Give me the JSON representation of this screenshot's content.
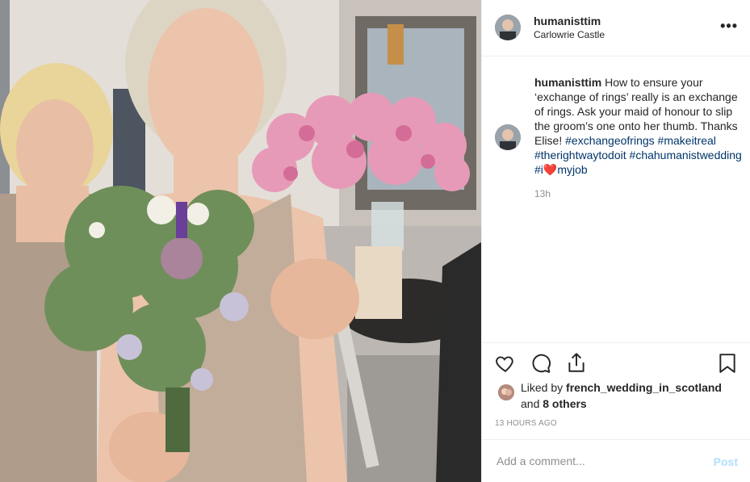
{
  "post": {
    "username": "humanisttim",
    "location": "Carlowrie Castle",
    "more_icon": "more-horizontal-icon",
    "caption": {
      "username": "humanisttim",
      "text": "How to ensure your ‘exchange of rings’ really is an exchange of rings. Ask your maid of honour to slip the groom’s one onto her thumb. Thanks Elise!",
      "hashtags": [
        "#exchangeofrings",
        "#makeitreal",
        "#therightwaytodoit",
        "#chahumanistwedding",
        "#i"
      ],
      "heart_emoji": "❤️",
      "tail_text": "myjob"
    },
    "caption_time": "13h",
    "likes": {
      "prefix": "Liked by",
      "user": "french_wedding_in_scotland",
      "and": "and",
      "others": "8 others"
    },
    "timestamp": "13 HOURS AGO",
    "comment_placeholder": "Add a comment...",
    "post_button": "Post"
  },
  "colors": {
    "link": "#003569",
    "muted": "#8e8e8e",
    "post_disabled": "#b2dffc"
  },
  "icons": [
    "heart-icon",
    "comment-icon",
    "share-icon",
    "bookmark-icon"
  ]
}
